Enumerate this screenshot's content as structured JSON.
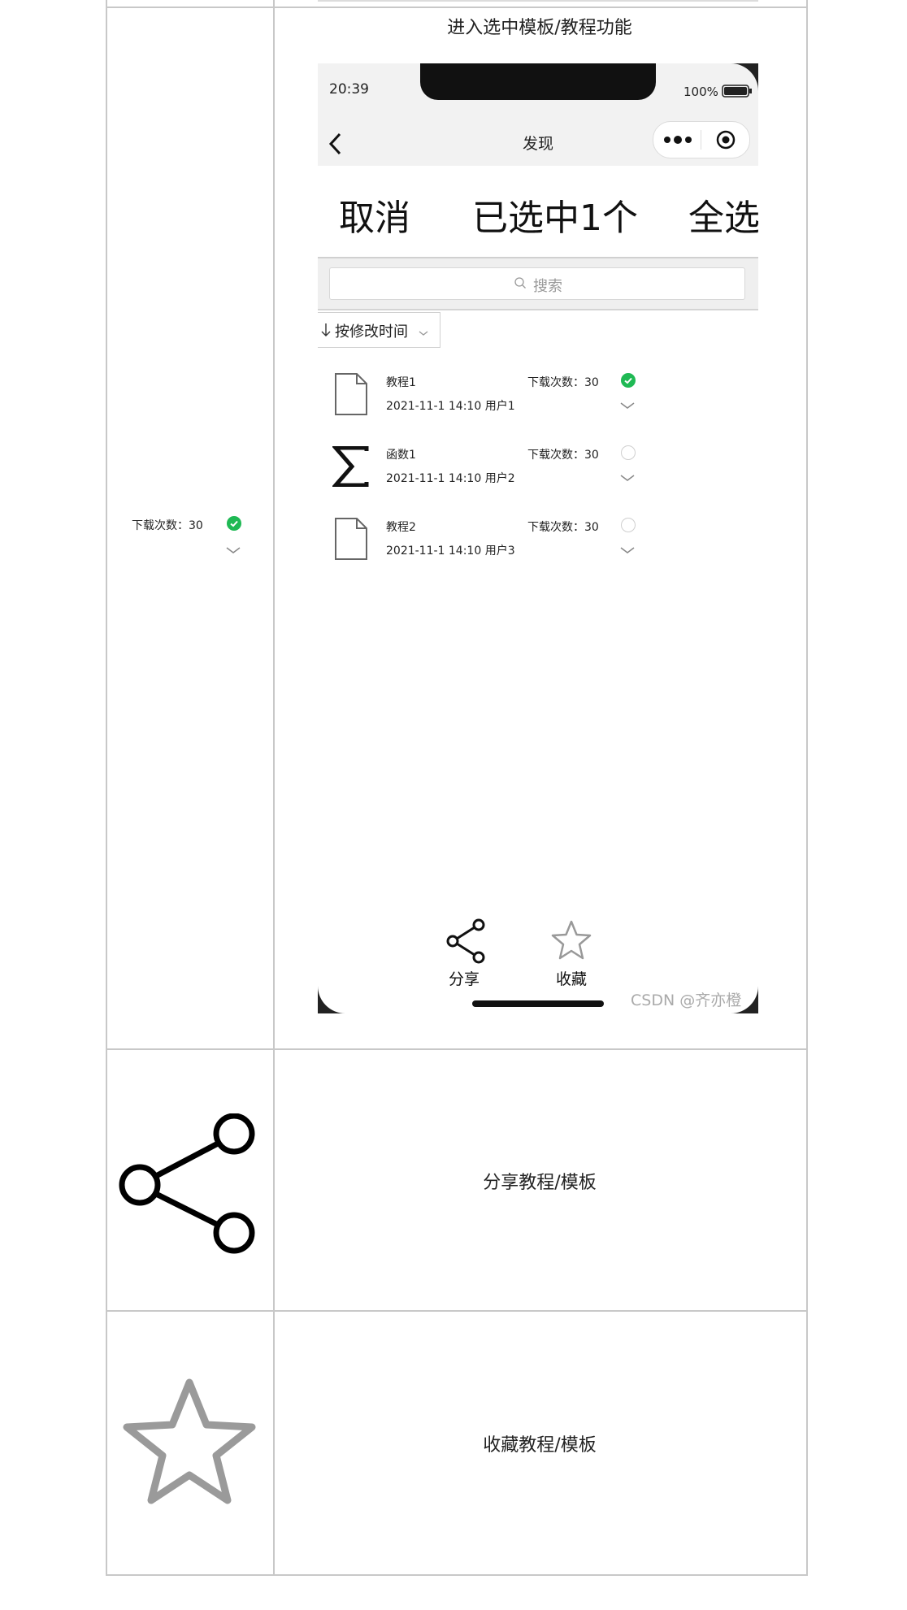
{
  "rows": {
    "selected_mode": {
      "caption": "进入选中模板/教程功能",
      "left_preview": {
        "download_label": "下载次数：30"
      }
    },
    "share": {
      "description": "分享教程/模板"
    },
    "favorite": {
      "description": "收藏教程/模板"
    }
  },
  "phone": {
    "status": {
      "time": "20:39",
      "battery": "100%"
    },
    "nav": {
      "title": "发现"
    },
    "select_bar": {
      "cancel": "取消",
      "count": "已选中1个",
      "select_all": "全选"
    },
    "search": {
      "placeholder": "搜索"
    },
    "sort": {
      "label": "按修改时间"
    },
    "files": [
      {
        "icon": "document-icon",
        "name": "教程1",
        "meta": "2021-11-1 14:10 用户1",
        "downloads": "下载次数：30",
        "selected": true
      },
      {
        "icon": "sigma-icon",
        "name": "函数1",
        "meta": "2021-11-1 14:10 用户2",
        "downloads": "下载次数：30",
        "selected": false
      },
      {
        "icon": "document-icon",
        "name": "教程2",
        "meta": "2021-11-1 14:10 用户3",
        "downloads": "下载次数：30",
        "selected": false
      }
    ],
    "bottom_bar": {
      "share": "分享",
      "favorite": "收藏"
    },
    "watermark": "CSDN @齐亦橙"
  },
  "colors": {
    "check_green": "#1fb954",
    "border": "#c8c8c8",
    "star_gray": "#9a9a9a"
  }
}
